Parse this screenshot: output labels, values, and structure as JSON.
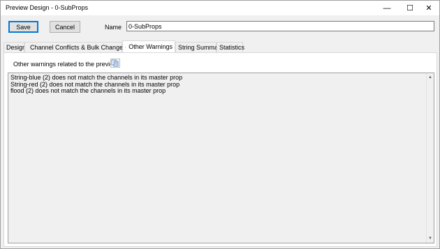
{
  "window": {
    "title": "Preview Design - 0-SubProps",
    "minimize_glyph": "—",
    "maximize_glyph": "☐",
    "close_glyph": "✕"
  },
  "toolbar": {
    "save_label": "Save",
    "cancel_label": "Cancel",
    "name_label": "Name",
    "name_value": "0-SubProps"
  },
  "tabs": [
    {
      "label": "Design",
      "warning": false
    },
    {
      "label": "Channel Conflicts & Bulk Changes",
      "warning": true
    },
    {
      "label": "Other Warnings",
      "warning": true,
      "active": true
    },
    {
      "label": "String Summary",
      "warning": false
    },
    {
      "label": "Statistics",
      "warning": false
    }
  ],
  "panel": {
    "heading": "Other warnings related to the preview",
    "copy_icon": "copy-to-clipboard-icon",
    "warnings": [
      "String-blue (2) does not match the channels in its master prop",
      "String-red (2) does not match the channels in its master prop",
      "flood (2) does not match the channels in its master prop"
    ]
  },
  "colors": {
    "accent": "#0078d7",
    "warning_fill": "#ffd800",
    "background": "#f0f0f0"
  }
}
